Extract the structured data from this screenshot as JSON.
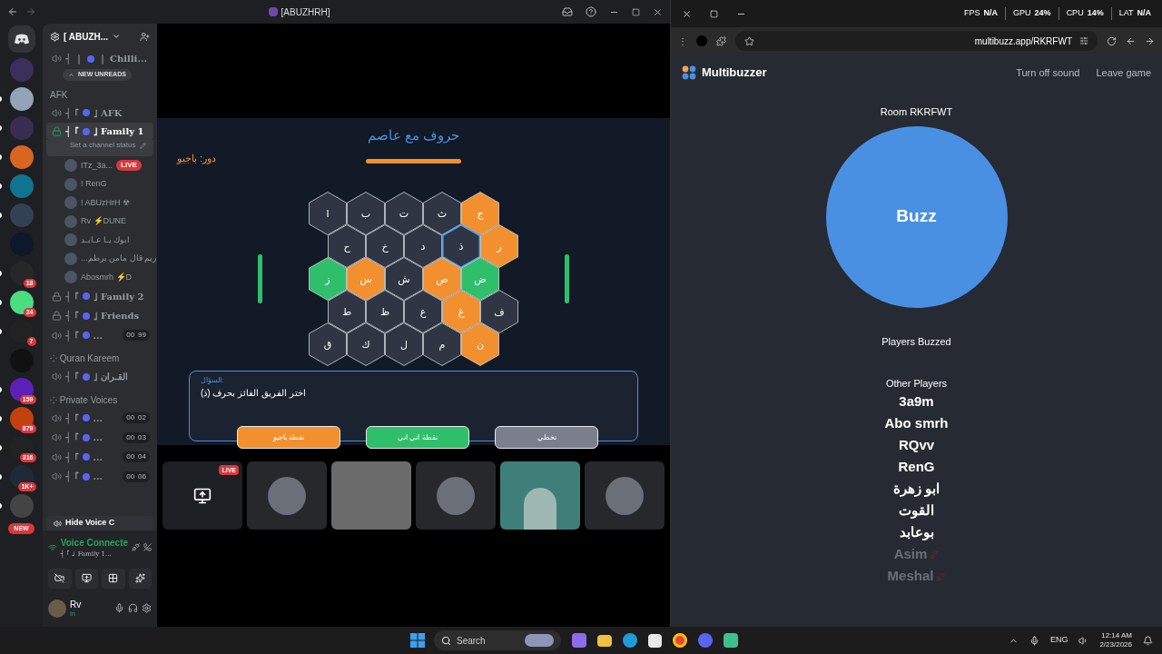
{
  "discord": {
    "title": "[ABUZHRH]",
    "server_name": "[ ABUZH...",
    "servers": [
      {
        "unread": false
      },
      {
        "unread": true
      },
      {
        "unread": true
      },
      {
        "unread": true
      },
      {
        "unread": true
      },
      {
        "unread": true
      },
      {
        "unread": false
      },
      {
        "badge": "18",
        "unread": true
      },
      {
        "badge": "24",
        "unread": true
      },
      {
        "badge": "7",
        "unread": true
      },
      {
        "unread": false
      },
      {
        "badge": "159",
        "unread": true
      },
      {
        "badge": "879",
        "unread": true
      },
      {
        "badge": "316",
        "unread": true
      },
      {
        "badge": "1K+",
        "unread": true
      },
      {
        "unread": true
      }
    ],
    "new_pill": "NEW",
    "unreads": "NEW UNREADS",
    "channels": [
      {
        "kind": "voice",
        "prefix": "┤ ｜",
        "suffix": "｜ Chilli...",
        "locked": false,
        "active": false
      },
      {
        "kind": "unreads"
      },
      {
        "kind": "category",
        "label": "AFK"
      },
      {
        "kind": "voice",
        "prefix": "┤ ｢",
        "suffix": "｣ AFK",
        "locked": false,
        "active": false
      },
      {
        "kind": "voice",
        "prefix": "┤ ｢",
        "suffix": "｣ Family 1",
        "locked": true,
        "active": true,
        "status": "Set a channel status"
      },
      {
        "kind": "member",
        "name": "ITz_3a...",
        "live": "LIVE"
      },
      {
        "kind": "member",
        "name": "! RenG"
      },
      {
        "kind": "member",
        "name": "! ABUzHrH ☢"
      },
      {
        "kind": "member",
        "name": "Rv ⚡DUNE"
      },
      {
        "kind": "member",
        "name": "ابوك يـا عـابـد"
      },
      {
        "kind": "member",
        "name": "...ريم قال مامن برطم"
      },
      {
        "kind": "member",
        "name": "Abosmrh ⚡D"
      },
      {
        "kind": "voice",
        "prefix": "┤ ｢",
        "suffix": "｣ Family 2",
        "locked": true,
        "active": false
      },
      {
        "kind": "voice",
        "prefix": "┤ ｢",
        "suffix": "｣ Friends",
        "locked": true,
        "active": false
      },
      {
        "kind": "voice",
        "prefix": "┤ ｢",
        "suffix": "...",
        "locked": false,
        "active": false,
        "count": [
          "00",
          "99"
        ]
      },
      {
        "kind": "category",
        "label": "⁘ Quran Kareem"
      },
      {
        "kind": "voice",
        "prefix": "┤ ｢",
        "suffix": "｣ القـران",
        "locked": false,
        "active": false
      },
      {
        "kind": "category",
        "label": "⁘ Private Voices"
      },
      {
        "kind": "voice",
        "prefix": "┤ ｢",
        "suffix": "...",
        "locked": false,
        "active": false,
        "count": [
          "00",
          "02"
        ]
      },
      {
        "kind": "voice",
        "prefix": "┤ ｢",
        "suffix": "...",
        "locked": false,
        "active": false,
        "count": [
          "00",
          "03"
        ]
      },
      {
        "kind": "voice",
        "prefix": "┤ ｢",
        "suffix": "...",
        "locked": false,
        "active": false,
        "count": [
          "00",
          "04"
        ]
      },
      {
        "kind": "voice",
        "prefix": "┤ ｢",
        "suffix": "...",
        "locked": false,
        "active": false,
        "count": [
          "00",
          "06"
        ]
      }
    ],
    "hide_voice": "Hide Voice C",
    "voice_panel": {
      "status": "Voice Connecte",
      "channel": "┤ ｢ ｣ Family 1..."
    },
    "user": {
      "name": "Rv",
      "status": "In"
    },
    "tiles": [
      {
        "kind": "screen",
        "live": "LIVE"
      },
      {
        "kind": "avatar"
      },
      {
        "kind": "blank"
      },
      {
        "kind": "avatar"
      },
      {
        "kind": "camera"
      },
      {
        "kind": "avatar"
      }
    ]
  },
  "game": {
    "title": "حروف مع عاصم",
    "turn": "دور: باجيو",
    "board": [
      [
        {
          "letter": "ج",
          "color": "#f2902f",
          "selected": false
        },
        {
          "letter": "ث",
          "color": "#2f3542",
          "selected": false
        },
        {
          "letter": "ت",
          "color": "#2f3542",
          "selected": false
        },
        {
          "letter": "ب",
          "color": "#2f3542",
          "selected": false
        },
        {
          "letter": "ا",
          "color": "#2f3542",
          "selected": false
        }
      ],
      [
        {
          "letter": "ر",
          "color": "#f2902f",
          "selected": false
        },
        {
          "letter": "ذ",
          "color": "#2f3542",
          "selected": true
        },
        {
          "letter": "د",
          "color": "#2f3542",
          "selected": false
        },
        {
          "letter": "خ",
          "color": "#2f3542",
          "selected": false
        },
        {
          "letter": "ح",
          "color": "#2f3542",
          "selected": false
        }
      ],
      [
        {
          "letter": "ض",
          "color": "#2fbf6a",
          "selected": false
        },
        {
          "letter": "ص",
          "color": "#f2902f",
          "selected": false
        },
        {
          "letter": "ش",
          "color": "#2f3542",
          "selected": false
        },
        {
          "letter": "س",
          "color": "#f2902f",
          "selected": false
        },
        {
          "letter": "ز",
          "color": "#2fbf6a",
          "selected": false
        }
      ],
      [
        {
          "letter": "ف",
          "color": "#2f3542",
          "selected": false
        },
        {
          "letter": "غ",
          "color": "#f2902f",
          "selected": false
        },
        {
          "letter": "ع",
          "color": "#2f3542",
          "selected": false
        },
        {
          "letter": "ظ",
          "color": "#2f3542",
          "selected": false
        },
        {
          "letter": "ط",
          "color": "#2f3542",
          "selected": false
        }
      ],
      [
        {
          "letter": "ن",
          "color": "#f2902f",
          "selected": false
        },
        {
          "letter": "م",
          "color": "#2f3542",
          "selected": false
        },
        {
          "letter": "ل",
          "color": "#2f3542",
          "selected": false
        },
        {
          "letter": "ك",
          "color": "#2f3542",
          "selected": false
        },
        {
          "letter": "ق",
          "color": "#2f3542",
          "selected": false
        }
      ]
    ],
    "question": {
      "label": "السؤال:",
      "text": "اختر الفريق الفائز بحرف (ذ)"
    },
    "buttons": [
      {
        "label": "تخطي",
        "kind": "grey"
      },
      {
        "label": "نقطة اني اني",
        "kind": "green"
      },
      {
        "label": "نقطة باجيو",
        "kind": "orange"
      }
    ]
  },
  "browser": {
    "menu": "⋮",
    "url": "multibuzz.app/RKRFWT",
    "stats": [
      {
        "name": "FPS",
        "value": "N/A"
      },
      {
        "name": "GPU",
        "value": "24%"
      },
      {
        "name": "CPU",
        "value": "14%"
      },
      {
        "name": "LAT",
        "value": "N/A"
      }
    ]
  },
  "buzzer": {
    "brand": "Multibuzzer",
    "actions": [
      "Turn off sound",
      "Leave game"
    ],
    "room": "Room RKRFWT",
    "buzz": "Buzz",
    "buzzed_heading": "Players Buzzed",
    "others_heading": "Other Players",
    "players": [
      {
        "name": "3a9m",
        "connected": true
      },
      {
        "name": "Abo smrh",
        "connected": true
      },
      {
        "name": "RQvv",
        "connected": true
      },
      {
        "name": "RenG",
        "connected": true
      },
      {
        "name": "ابو زهرة",
        "connected": true
      },
      {
        "name": "القوت",
        "connected": true
      },
      {
        "name": "بوعابد",
        "connected": true
      },
      {
        "name": "Asim",
        "connected": false
      },
      {
        "name": "Meshal",
        "connected": false
      }
    ]
  },
  "taskbar": {
    "search": "Search",
    "lang": "ENG",
    "time": "12:14 AM",
    "date": "2/23/2026"
  }
}
